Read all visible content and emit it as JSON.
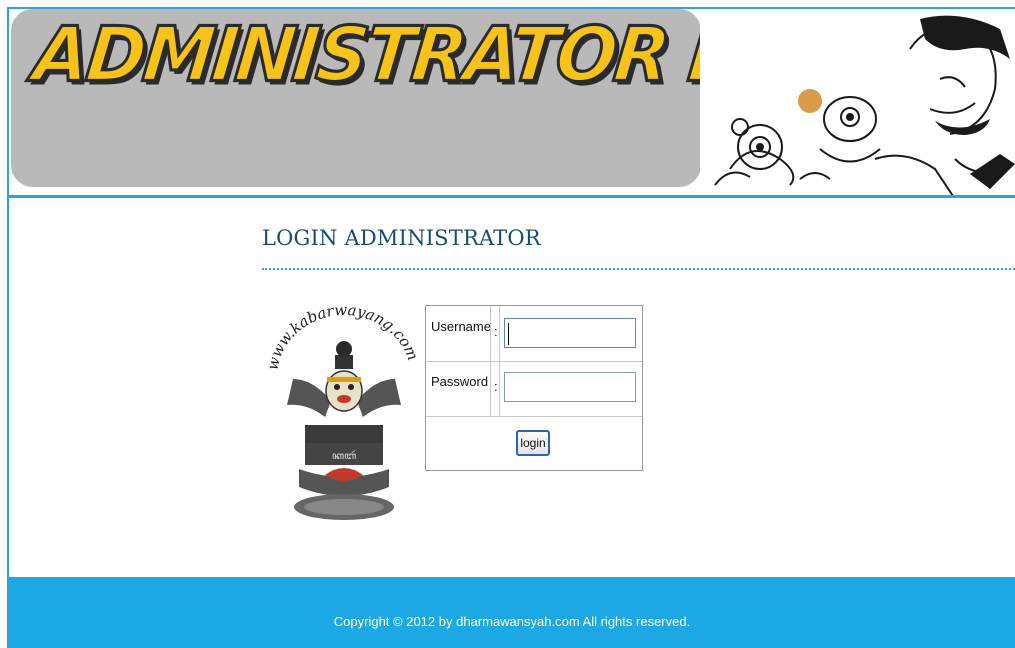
{
  "header": {
    "banner_title": "ADMINISTRATOR PANEL",
    "banner_color": "#f7c21a",
    "bubble_color": "#b9b9b9",
    "accent_color": "#2aa5df",
    "art_icon": "wayang-comic-illustration"
  },
  "section": {
    "title": "LOGIN ADMINISTRATOR"
  },
  "logo": {
    "icon": "kabarwayang-garuda-logo",
    "arc_text": "www.kabarwayang.com"
  },
  "login_form": {
    "username_label": "Username",
    "password_label": "Password",
    "separator": ":",
    "username_value": "",
    "password_value": "",
    "submit_label": "login"
  },
  "footer": {
    "copyright": "Copyright © 2012 by dharmawansyah.com All rights reserved.",
    "background_color": "#1ba8e4"
  }
}
